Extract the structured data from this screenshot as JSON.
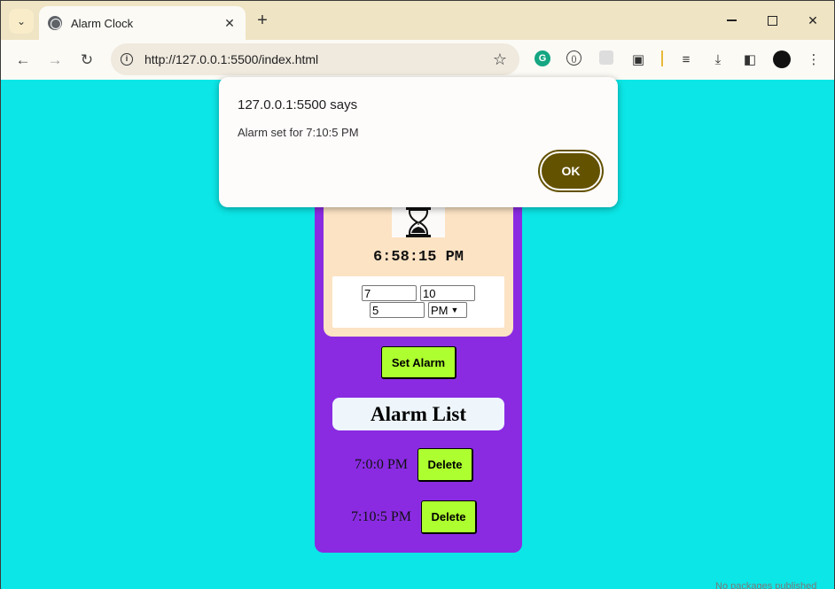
{
  "browser": {
    "tab_title": "Alarm Clock",
    "url": "http://127.0.0.1:5500/index.html"
  },
  "page": {
    "current_time": "6:58:15 PM",
    "inputs": {
      "hour": "7",
      "minute": "10",
      "second": "5",
      "ampm": "PM"
    },
    "set_alarm_label": "Set Alarm",
    "alarm_list_title": "Alarm List",
    "alarms": [
      {
        "time": "7:0:0 PM",
        "delete_label": "Delete"
      },
      {
        "time": "7:10:5 PM",
        "delete_label": "Delete"
      }
    ],
    "edge_text": "No packages published"
  },
  "dialog": {
    "origin": "127.0.0.1:5500 says",
    "message": "Alarm set for 7:10:5 PM",
    "ok_label": "OK"
  },
  "colors": {
    "page_bg": "#0ce6e6",
    "card_bg": "#8a2be2",
    "clock_box_bg": "#fce3c4",
    "button_bg": "#adff2f",
    "dialog_ok_bg": "#635200",
    "tabstrip_bg": "#efe4c4"
  }
}
